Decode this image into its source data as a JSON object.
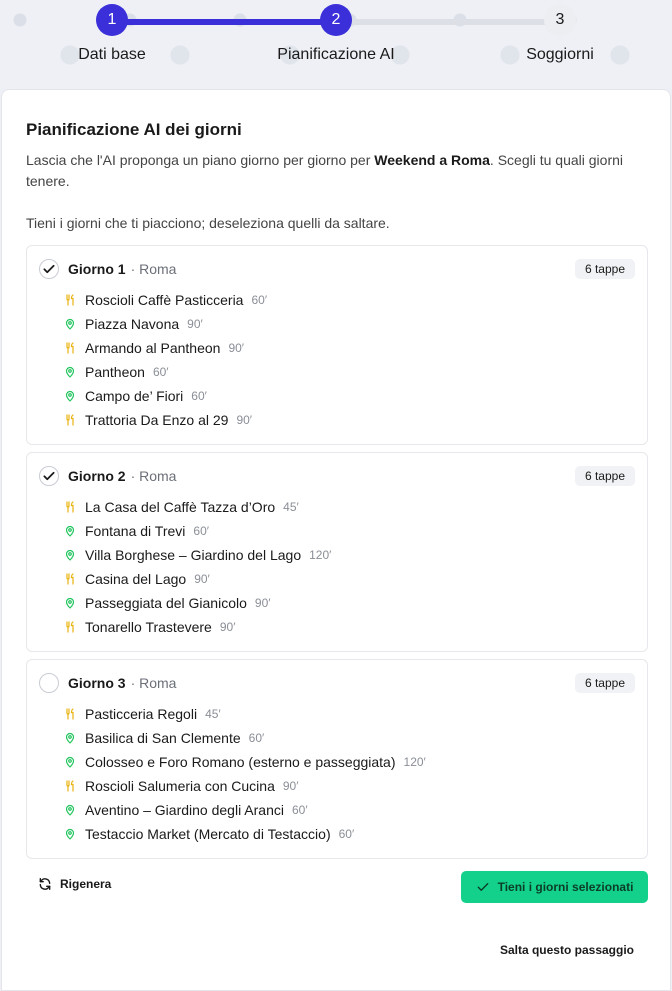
{
  "stepper": {
    "steps": [
      {
        "number": "1",
        "label": "Dati base",
        "state": "completed"
      },
      {
        "number": "2",
        "label": "Pianificazione AI",
        "state": "current"
      },
      {
        "number": "3",
        "label": "Soggiorni",
        "state": "pending"
      }
    ]
  },
  "card": {
    "title": "Pianificazione AI dei giorni",
    "desc_prefix": "Lascia che l'AI proponga un piano giorno per giorno per ",
    "trip_name": "Weekend a Roma",
    "desc_suffix": ". Scegli tu quali giorni tenere.",
    "hint": "Tieni i giorni che ti piacciono; deseleziona quelli da saltare."
  },
  "days": [
    {
      "name": "Giorno 1",
      "city": "· Roma",
      "badge": "6 tappe",
      "checked": true,
      "stops": [
        {
          "type": "food",
          "name": "Roscioli Caffè Pasticceria",
          "duration": "60′"
        },
        {
          "type": "place",
          "name": "Piazza Navona",
          "duration": "90′"
        },
        {
          "type": "food",
          "name": "Armando al Pantheon",
          "duration": "90′"
        },
        {
          "type": "place",
          "name": "Pantheon",
          "duration": "60′"
        },
        {
          "type": "place",
          "name": "Campo de’ Fiori",
          "duration": "60′"
        },
        {
          "type": "food",
          "name": "Trattoria Da Enzo al 29",
          "duration": "90′"
        }
      ]
    },
    {
      "name": "Giorno 2",
      "city": "· Roma",
      "badge": "6 tappe",
      "checked": true,
      "stops": [
        {
          "type": "food",
          "name": "La Casa del Caffè Tazza d’Oro",
          "duration": "45′"
        },
        {
          "type": "place",
          "name": "Fontana di Trevi",
          "duration": "60′"
        },
        {
          "type": "place",
          "name": "Villa Borghese – Giardino del Lago",
          "duration": "120′"
        },
        {
          "type": "food",
          "name": "Casina del Lago",
          "duration": "90′"
        },
        {
          "type": "place",
          "name": "Passeggiata del Gianicolo",
          "duration": "90′"
        },
        {
          "type": "food",
          "name": "Tonarello Trastevere",
          "duration": "90′"
        }
      ]
    },
    {
      "name": "Giorno 3",
      "city": "· Roma",
      "badge": "6 tappe",
      "checked": false,
      "stops": [
        {
          "type": "food",
          "name": "Pasticceria Regoli",
          "duration": "45′"
        },
        {
          "type": "place",
          "name": "Basilica di San Clemente",
          "duration": "60′"
        },
        {
          "type": "place",
          "name": "Colosseo e Foro Romano (esterno e passeggiata)",
          "duration": "120′"
        },
        {
          "type": "food",
          "name": "Roscioli Salumeria con Cucina",
          "duration": "90′"
        },
        {
          "type": "place",
          "name": "Aventino – Giardino degli Aranci",
          "duration": "60′"
        },
        {
          "type": "place",
          "name": "Testaccio Market (Mercato di Testaccio)",
          "duration": "60′"
        }
      ]
    }
  ],
  "actions": {
    "regenerate": "Rigenera",
    "keep": "Tieni i giorni selezionati",
    "skip": "Salta questo passaggio"
  },
  "colors": {
    "primary": "#3b2fd9",
    "success": "#13d18a",
    "food_icon": "#e8b20e",
    "place_icon": "#22c55e"
  },
  "icons": {
    "food": "fork-knife-icon",
    "place": "map-pin-icon",
    "check": "checkmark-icon",
    "regenerate": "refresh-icon"
  }
}
